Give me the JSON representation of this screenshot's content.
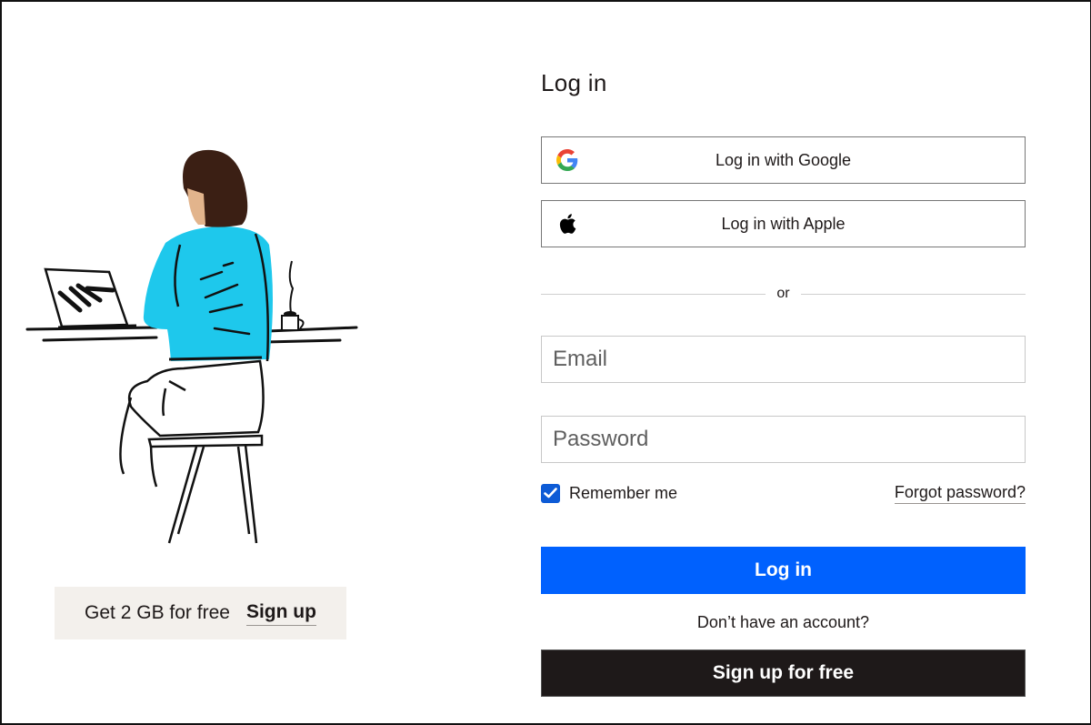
{
  "page": {
    "title": "Log in"
  },
  "sso": {
    "google_label": "Log in with Google",
    "google_icon": "google-logo-icon",
    "apple_label": "Log in with Apple",
    "apple_icon": "apple-logo-icon"
  },
  "divider": {
    "label": "or"
  },
  "fields": {
    "email": {
      "placeholder": "Email",
      "value": ""
    },
    "password": {
      "placeholder": "Password",
      "value": ""
    }
  },
  "options": {
    "remember_label": "Remember me",
    "remember_checked": true,
    "forgot_label": "Forgot password?"
  },
  "actions": {
    "login_label": "Log in",
    "no_account_text": "Don’t have an account?",
    "signup_label": "Sign up for free"
  },
  "promo": {
    "text": "Get 2 GB for free",
    "link_label": "Sign up"
  },
  "illustration": {
    "subject": "person-at-laptop-illustration"
  },
  "colors": {
    "primary": "#0061fe",
    "dark": "#1e1919",
    "checkbox": "#0d5bd6",
    "promo_bg": "#f3f0ec",
    "sweater": "#1ec8ec"
  }
}
